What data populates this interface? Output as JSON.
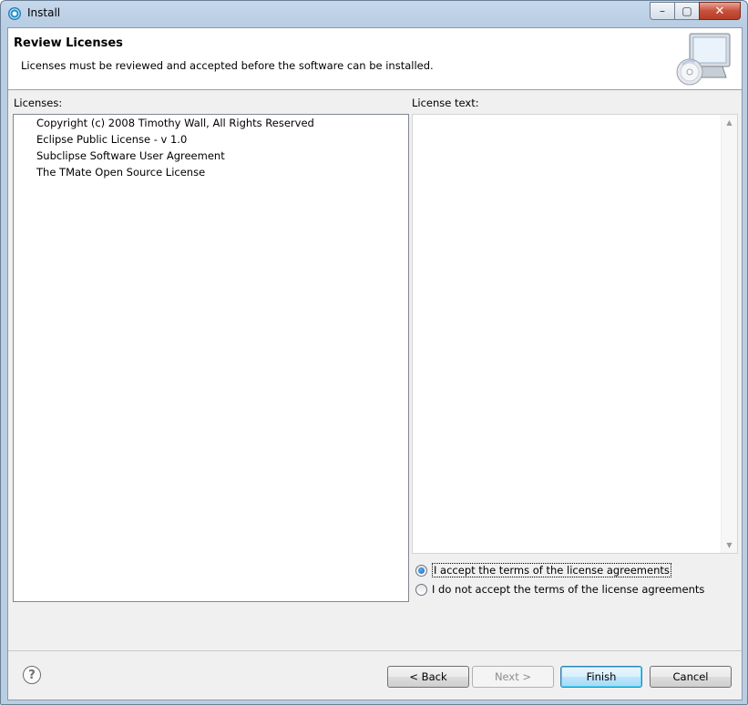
{
  "window": {
    "title": "Install",
    "minimize_glyph": "–",
    "maximize_glyph": "▢",
    "close_glyph": "✕"
  },
  "header": {
    "title": "Review Licenses",
    "description": "Licenses must be reviewed and accepted before the software can be installed."
  },
  "licenses": {
    "label": "Licenses:",
    "items": [
      "Copyright (c) 2008 Timothy Wall, All Rights Reserved",
      "Eclipse Public License - v 1.0",
      "Subclipse Software User Agreement",
      "The TMate Open Source License"
    ]
  },
  "license_text": {
    "label": "License text:",
    "content": ""
  },
  "radios": {
    "accept": "I accept the terms of the license agreements",
    "decline": "I do not accept the terms of the license agreements",
    "selected": "accept"
  },
  "footer": {
    "help_glyph": "?",
    "back": "< Back",
    "next": "Next >",
    "finish": "Finish",
    "cancel": "Cancel"
  },
  "icons": {
    "app": "eclipse-install-icon",
    "header": "computer-cd-icon",
    "help": "help-icon"
  }
}
